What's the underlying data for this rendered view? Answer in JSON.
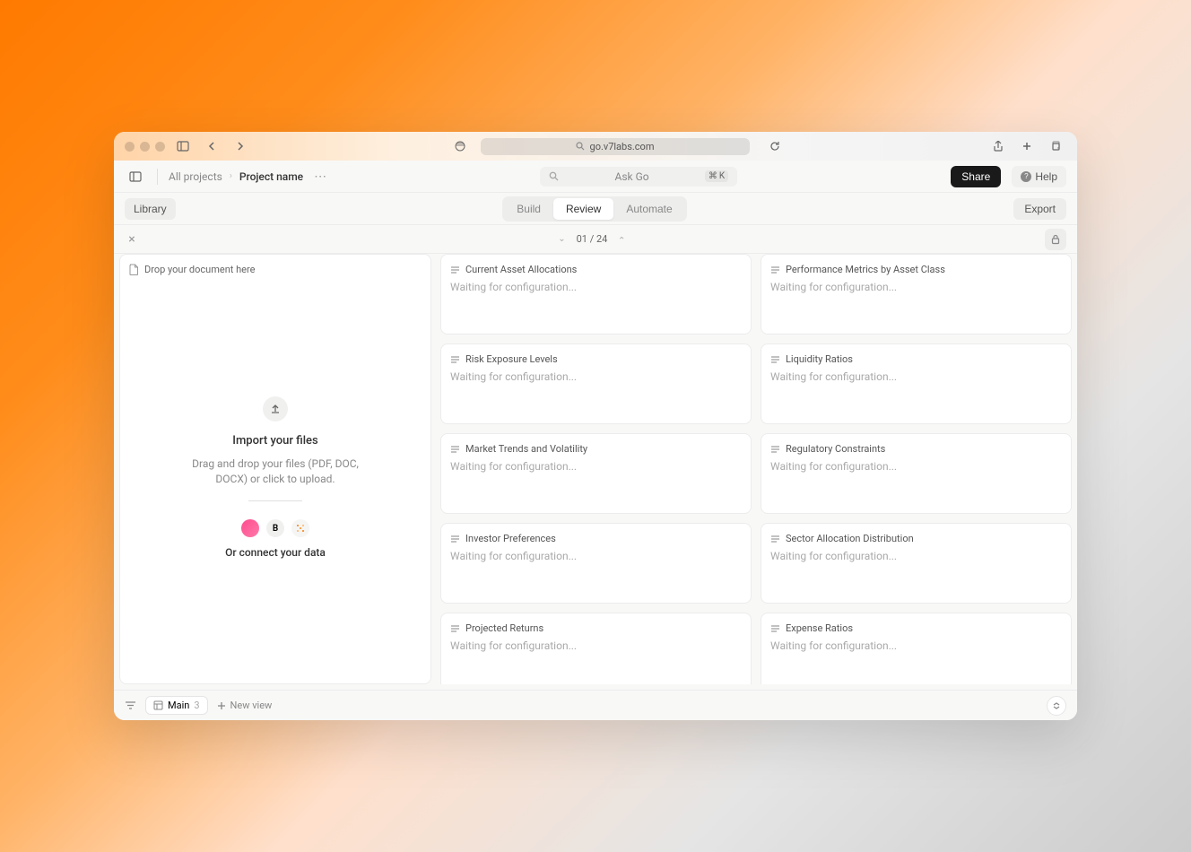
{
  "browser": {
    "url": "go.v7labs.com"
  },
  "header": {
    "breadcrumb_root": "All projects",
    "breadcrumb_current": "Project name",
    "ask_go_placeholder": "Ask Go",
    "shortcut_key": "K",
    "share_label": "Share",
    "help_label": "Help"
  },
  "subheader": {
    "library_label": "Library",
    "tabs": {
      "build": "Build",
      "review": "Review",
      "automate": "Automate"
    },
    "export_label": "Export"
  },
  "pagebar": {
    "pagination": "01 / 24"
  },
  "drop": {
    "header": "Drop your document here",
    "import_title": "Import your files",
    "import_desc": "Drag and drop your files (PDF, DOC, DOCX) or click to upload.",
    "connect_text": "Or connect your data",
    "integration_b": "B"
  },
  "cards_col1": [
    {
      "title": "Current Asset Allocations",
      "status": "Waiting for configuration..."
    },
    {
      "title": "Risk Exposure Levels",
      "status": "Waiting for configuration..."
    },
    {
      "title": "Market Trends and Volatility",
      "status": "Waiting for configuration..."
    },
    {
      "title": "Investor Preferences",
      "status": "Waiting for configuration..."
    },
    {
      "title": "Projected Returns",
      "status": "Waiting for configuration..."
    }
  ],
  "cards_col2": [
    {
      "title": "Performance Metrics by Asset Class",
      "status": "Waiting for configuration..."
    },
    {
      "title": "Liquidity Ratios",
      "status": "Waiting for configuration..."
    },
    {
      "title": "Regulatory Constraints",
      "status": "Waiting for configuration..."
    },
    {
      "title": "Sector Allocation Distribution",
      "status": "Waiting for configuration..."
    },
    {
      "title": "Expense Ratios",
      "status": "Waiting for configuration..."
    }
  ],
  "footer": {
    "view_name": "Main",
    "view_count": "3",
    "new_view_label": "New view"
  }
}
